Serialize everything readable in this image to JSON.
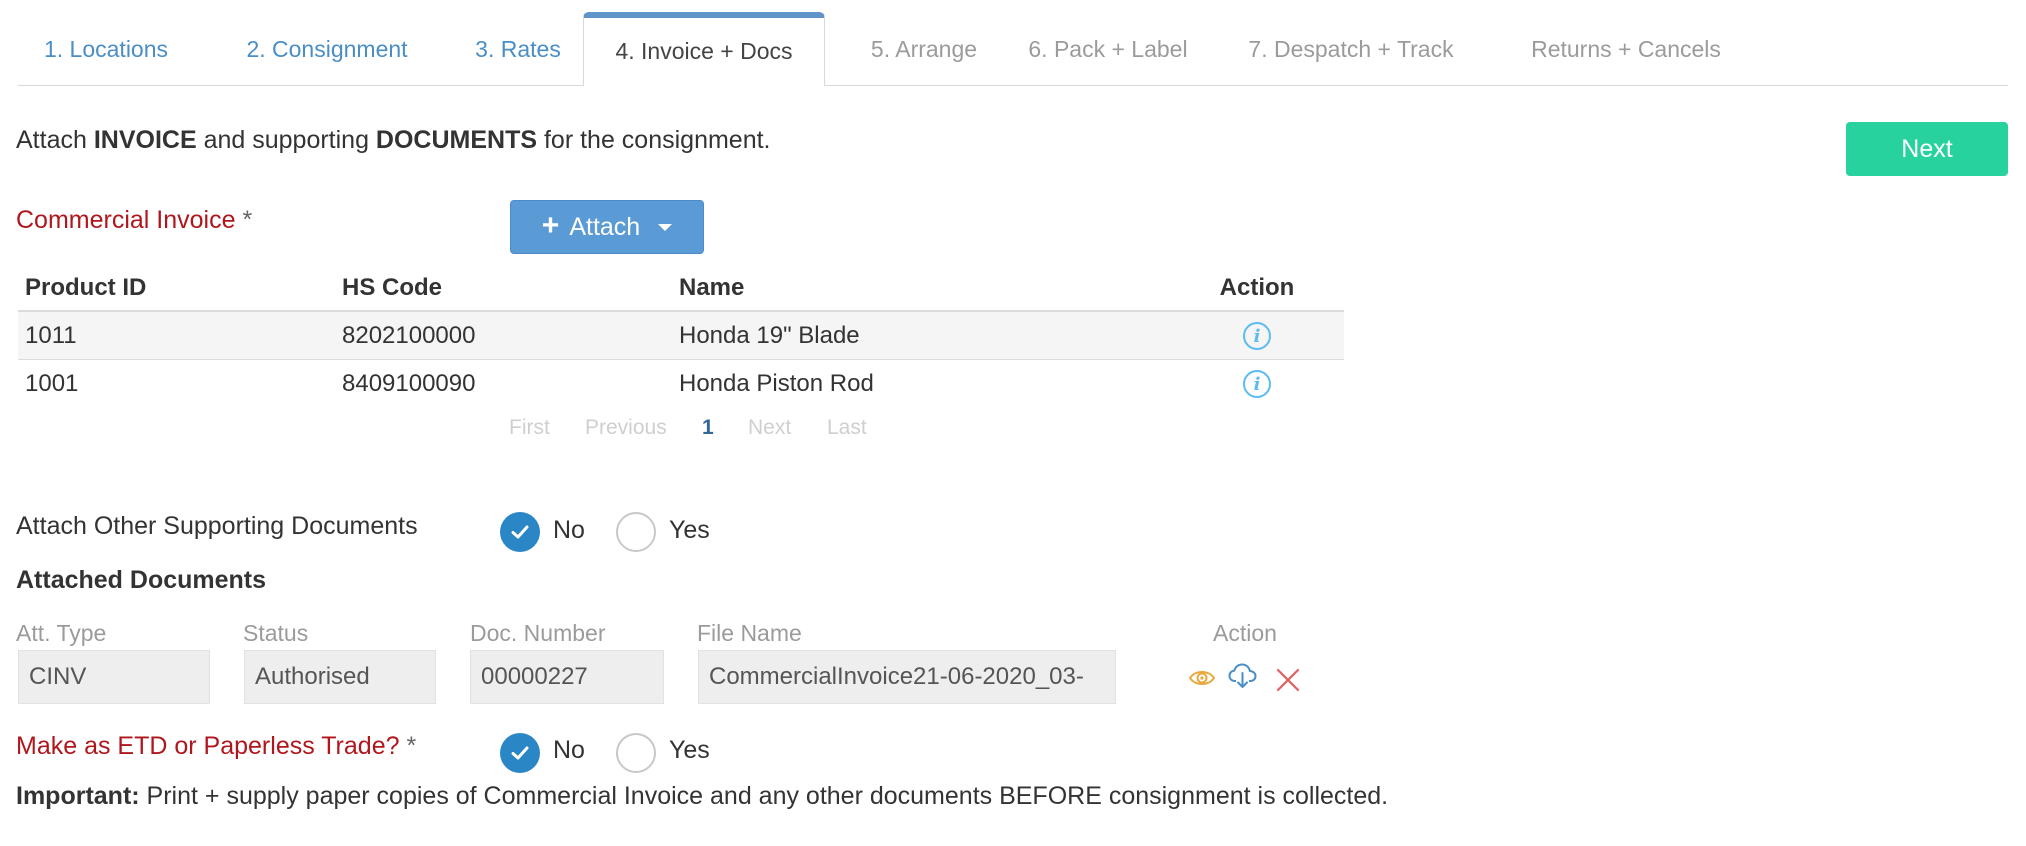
{
  "tabs": [
    {
      "label": "1. Locations",
      "state": "enabled"
    },
    {
      "label": "2. Consignment",
      "state": "enabled"
    },
    {
      "label": "3. Rates",
      "state": "enabled"
    },
    {
      "label": "4. Invoice + Docs",
      "state": "active"
    },
    {
      "label": "5. Arrange",
      "state": "disabled"
    },
    {
      "label": "6. Pack + Label",
      "state": "disabled"
    },
    {
      "label": "7. Despatch + Track",
      "state": "disabled"
    },
    {
      "label": "Returns + Cancels",
      "state": "disabled"
    }
  ],
  "intro": {
    "part1": "Attach ",
    "bold1": "INVOICE",
    "part2": " and supporting ",
    "bold2": "DOCUMENTS",
    "part3": " for the consignment."
  },
  "next_label": "Next",
  "commercial_invoice": {
    "label": "Commercial Invoice",
    "required_mark": "*",
    "attach_label": "Attach",
    "table": {
      "headers": [
        "Product ID",
        "HS Code",
        "Name",
        "Action"
      ],
      "rows": [
        [
          "1011",
          "8202100000",
          "Honda 19\" Blade"
        ],
        [
          "1001",
          "8409100090",
          "Honda Piston Rod"
        ]
      ]
    },
    "pagination": {
      "first": "First",
      "previous": "Previous",
      "current": "1",
      "next": "Next",
      "last": "Last"
    }
  },
  "other_docs": {
    "label": "Attach Other Supporting Documents",
    "options": [
      "No",
      "Yes"
    ],
    "selected": "No"
  },
  "attached": {
    "heading": "Attached Documents",
    "columns": [
      "Att. Type",
      "Status",
      "Doc. Number",
      "File Name",
      "Action"
    ],
    "row": {
      "att_type": "CINV",
      "status": "Authorised",
      "doc_number": "00000227",
      "file_name": "CommercialInvoice21-06-2020_03-"
    },
    "action_icons": [
      "eye-icon",
      "cloud-download-icon",
      "close-icon"
    ],
    "colors": {
      "eye": "#e8a93c",
      "download": "#4a8ec6",
      "delete": "#e06060"
    }
  },
  "etd": {
    "label": "Make as ETD or Paperless Trade?",
    "required_mark": "*",
    "options": [
      "No",
      "Yes"
    ],
    "selected": "No"
  },
  "important": {
    "bold": "Important:",
    "text": " Print + supply paper copies of Commercial Invoice and any other documents BEFORE consignment is collected."
  },
  "colors": {
    "accent_blue": "#5b9bd5",
    "next_green": "#27d29f",
    "required_red": "#b0171d",
    "radio_blue": "#2b86c5",
    "info_blue": "#5bbcf3"
  }
}
